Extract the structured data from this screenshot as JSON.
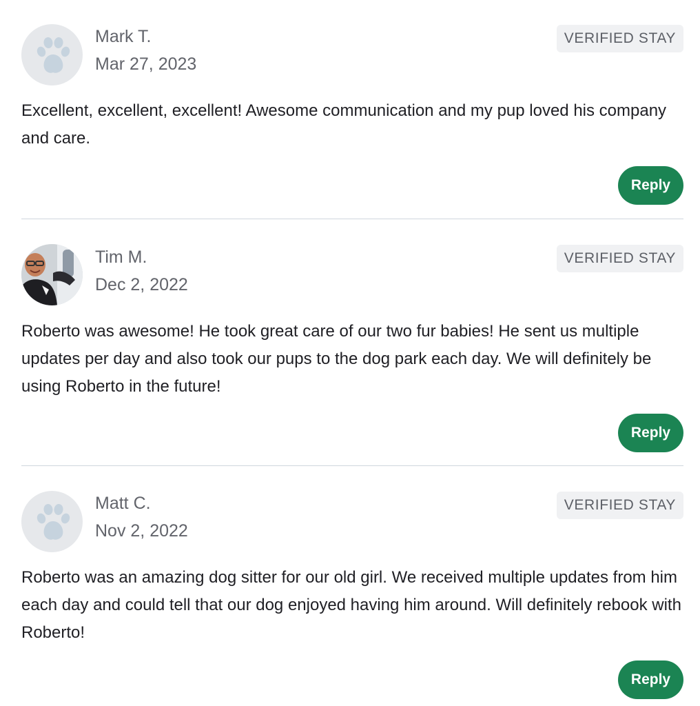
{
  "reviews": [
    {
      "name": "Mark T.",
      "date": "Mar 27, 2023",
      "badge": "VERIFIED STAY",
      "text": "Excellent, excellent, excellent! Awesome communication and my pup loved his company and care.",
      "reply_label": "Reply",
      "avatar": "paw-icon"
    },
    {
      "name": "Tim M.",
      "date": "Dec 2, 2022",
      "badge": "VERIFIED STAY",
      "text": "Roberto was awesome! He took great care of our two fur babies! He sent us multiple updates per day and also took our pups to the dog park each day. We will definitely be using Roberto in the future!",
      "reply_label": "Reply",
      "avatar": "user-photo"
    },
    {
      "name": "Matt C.",
      "date": "Nov 2, 2022",
      "badge": "VERIFIED STAY",
      "text": "Roberto was an amazing dog sitter for our old girl. We received multiple updates from him each day and could tell that our dog enjoyed having him around. Will definitely rebook with Roberto!",
      "reply_label": "Reply",
      "avatar": "paw-icon"
    }
  ],
  "colors": {
    "reply_button": "#1b8453",
    "badge_background": "#f0f1f3",
    "paw": "#c6d3de",
    "avatar_background": "#e6e8eb",
    "divider": "#cfd6dd"
  }
}
